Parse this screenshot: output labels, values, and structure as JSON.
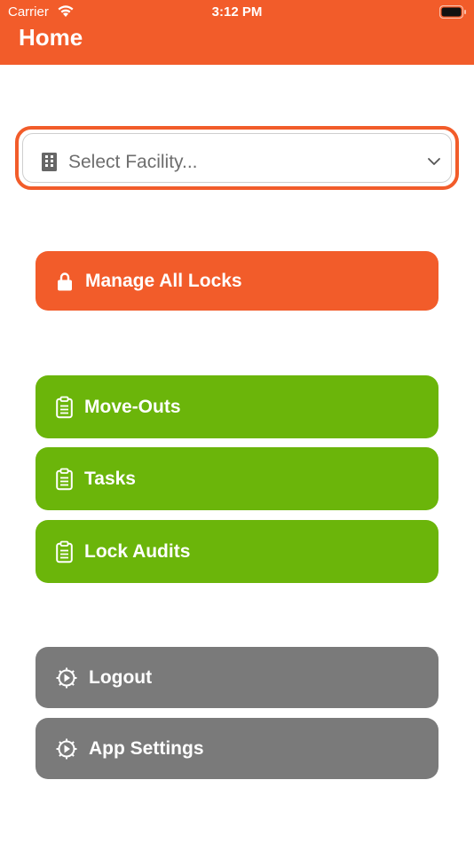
{
  "status_bar": {
    "carrier": "Carrier",
    "time": "3:12 PM"
  },
  "header": {
    "title": "Home"
  },
  "facility_select": {
    "placeholder": "Select Facility...",
    "icon": "building-icon"
  },
  "buttons": {
    "manage_all_locks": "Manage All Locks",
    "move_outs": "Move-Outs",
    "tasks": "Tasks",
    "lock_audits": "Lock Audits",
    "logout": "Logout",
    "app_settings": "App Settings"
  },
  "colors": {
    "brand_orange": "#f25c2a",
    "action_green": "#6bb50a",
    "neutral_gray": "#7a7a7a"
  }
}
